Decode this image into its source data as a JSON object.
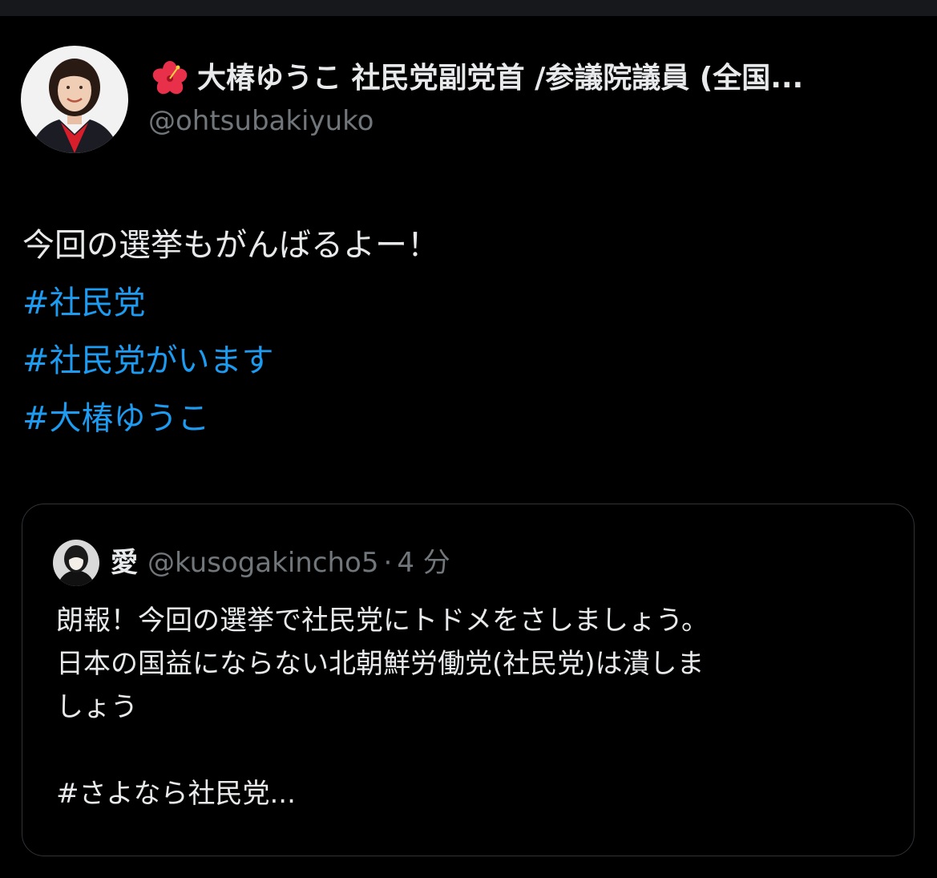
{
  "tweet": {
    "author": {
      "display_name": "大椿ゆうこ 社民党副党首 /参議院議員 (全国...",
      "handle": "@ohtsubakiyuko",
      "name_emoji": "hibiscus-icon"
    },
    "body_lines": [
      "今回の選挙もがんばるよー！"
    ],
    "hashtags": [
      "#社民党",
      "#社民党がいます",
      "#大椿ゆうこ"
    ]
  },
  "quote": {
    "author_name": "愛",
    "handle": "@kusogakincho5",
    "separator": "·",
    "time": "4 分",
    "text_lines": [
      "朗報！今回の選挙で社民党にトドメをさしましょう。",
      "日本の国益にならない北朝鮮労働党(社民党)は潰しま",
      "しょう",
      "",
      " #さよなら社民党..."
    ]
  },
  "colors": {
    "background": "#000000",
    "text": "#e7e9ea",
    "secondary": "#71767b",
    "link": "#1d9bf0",
    "border": "#2f3336"
  }
}
